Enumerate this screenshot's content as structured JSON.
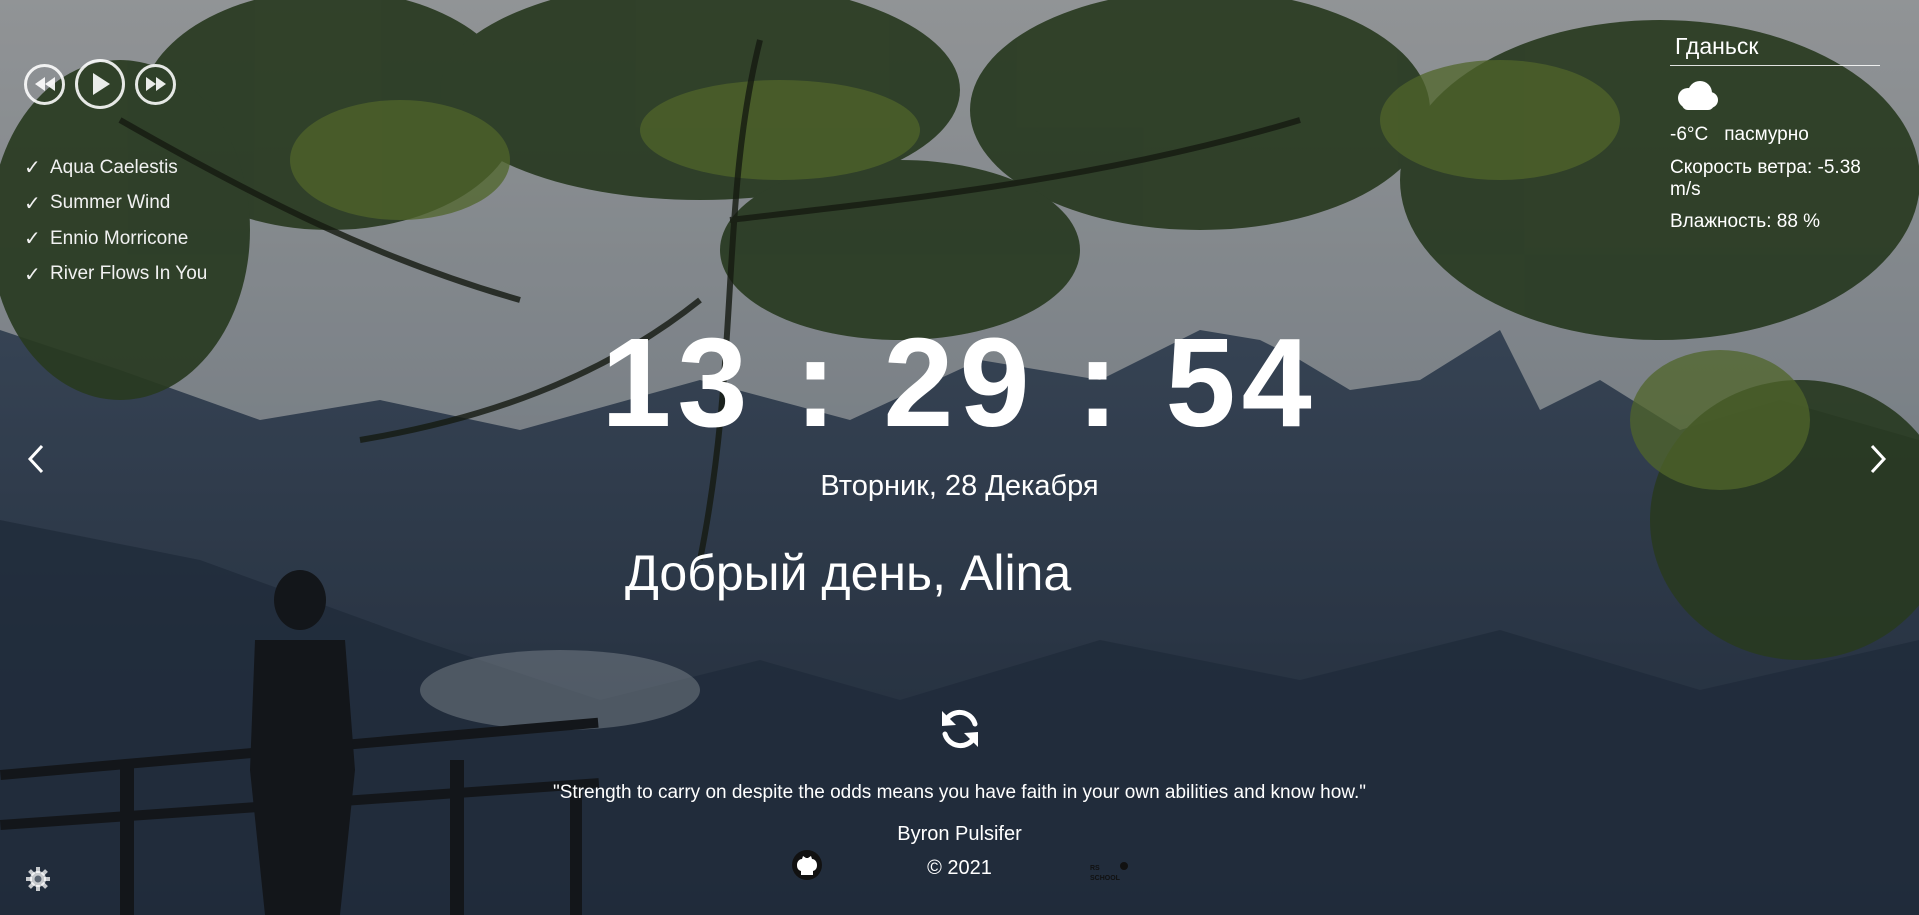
{
  "player": {
    "prev_icon": "rewind-icon",
    "play_icon": "play-icon",
    "next_icon": "fast-forward-icon",
    "playlist": [
      {
        "check": "✓",
        "title": "Aqua Caelestis"
      },
      {
        "check": "✓",
        "title": "Summer Wind"
      },
      {
        "check": "✓",
        "title": "Ennio Morricone"
      },
      {
        "check": "✓",
        "title": "River Flows In You"
      }
    ]
  },
  "weather": {
    "city": "Гданьск",
    "icon": "cloud-icon",
    "temperature": "-6°C",
    "description": "пасмурно",
    "wind": "Скорость ветра: -5.38 m/s",
    "humidity": "Влажность: 88 %"
  },
  "clock": {
    "time": "13 : 29 : 54",
    "date": "Вторник, 28 Декабря"
  },
  "greeting": {
    "text": "Добрый день,",
    "name": "Alina"
  },
  "quote": {
    "text": "\"Strength to carry on despite the odds means you have faith in your own abilities and know how.\"",
    "author": "Byron Pulsifer"
  },
  "footer": {
    "copyright": "© 2021",
    "github_icon": "github-icon",
    "school_logo": "rs-school-logo"
  },
  "colors": {
    "text": "#ffffff",
    "background": "#5f6f7d"
  }
}
